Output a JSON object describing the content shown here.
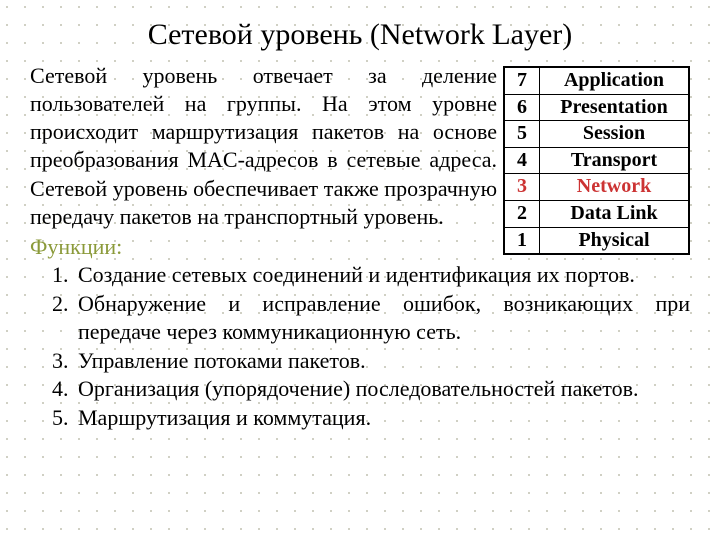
{
  "title": "Сетевой уровень (Network Layer)",
  "paragraph": "Сетевой уровень отвечает за деление пользователей на группы. На этом уровне происходит маршрутизация пакетов на основе преобразования MAC-адресов в сетевые адреса. Сетевой уровень обеспечивает также прозрачную передачу пакетов на транспортный уровень.",
  "functions_label": "Функции:",
  "functions": [
    "Создание сетевых соединений и идентификация их портов.",
    "Обнаружение и исправление ошибок, возникающих при передаче через коммуникационную сеть.",
    "Управление потоками пакетов.",
    "Организация (упорядочение) последовательностей пакетов.",
    "Маршрутизация и коммутация."
  ],
  "osi": [
    {
      "n": "7",
      "name": "Application",
      "hl": false
    },
    {
      "n": "6",
      "name": "Presentation",
      "hl": false
    },
    {
      "n": "5",
      "name": "Session",
      "hl": false
    },
    {
      "n": "4",
      "name": "Transport",
      "hl": false
    },
    {
      "n": "3",
      "name": "Network",
      "hl": true
    },
    {
      "n": "2",
      "name": "Data Link",
      "hl": false
    },
    {
      "n": "1",
      "name": "Physical",
      "hl": false
    }
  ]
}
